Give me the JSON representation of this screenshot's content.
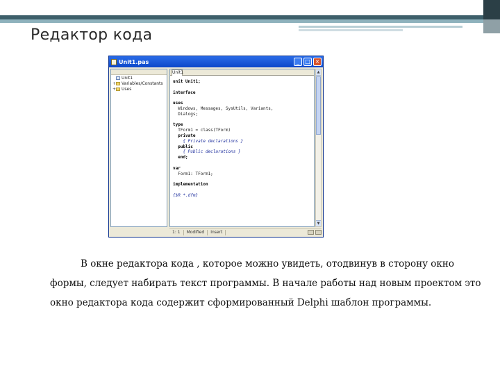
{
  "slide": {
    "title": "Редактор кода",
    "paragraph_lines": [
      "В окне редактора кода , которое можно увидеть, отодвинув в сторону окно",
      "формы, следует набирать текст программы. В начале работы над новым проектом это",
      "окно редактора кода содержит сформированный Delphi шаблон программы."
    ]
  },
  "ide": {
    "window_title": "Unit1.pas",
    "title_buttons": [
      "_",
      "□",
      "×"
    ],
    "editor_tab": "Unit1",
    "explorer_items": [
      {
        "toggle": "",
        "label": "Unit1",
        "icon": "unit-icon"
      },
      {
        "toggle": "+",
        "label": "Variables/Constants",
        "icon": "folder-icon"
      },
      {
        "toggle": "+",
        "label": "Uses",
        "icon": "folder-icon"
      }
    ],
    "code_lines": [
      {
        "text": "unit Unit1;",
        "style": "kw"
      },
      {
        "text": "",
        "style": ""
      },
      {
        "text": "interface",
        "style": "kw"
      },
      {
        "text": "",
        "style": ""
      },
      {
        "text": "uses",
        "style": "kw"
      },
      {
        "text": "  Windows, Messages, SysUtils, Variants,",
        "style": ""
      },
      {
        "text": "  Dialogs;",
        "style": ""
      },
      {
        "text": "",
        "style": ""
      },
      {
        "text": "type",
        "style": "kw"
      },
      {
        "text": "  TForm1 = class(TForm)",
        "style": ""
      },
      {
        "text": "  private",
        "style": "kw"
      },
      {
        "text": "    { Private declarations }",
        "style": "cm"
      },
      {
        "text": "  public",
        "style": "kw"
      },
      {
        "text": "    { Public declarations }",
        "style": "cm"
      },
      {
        "text": "  end;",
        "style": "kw"
      },
      {
        "text": "",
        "style": ""
      },
      {
        "text": "var",
        "style": "kw"
      },
      {
        "text": "  Form1: TForm1;",
        "style": ""
      },
      {
        "text": "",
        "style": ""
      },
      {
        "text": "implementation",
        "style": "kw"
      },
      {
        "text": "",
        "style": ""
      },
      {
        "text": "{$R *.dfm}",
        "style": "cm"
      }
    ],
    "status": {
      "position": "1: 1",
      "mode": "Modified",
      "insert": "Insert"
    }
  },
  "colors": {
    "header_band": "#3d5f6a",
    "header_band_light": "#8fb2bd",
    "titlebar": "#0b47c9"
  }
}
